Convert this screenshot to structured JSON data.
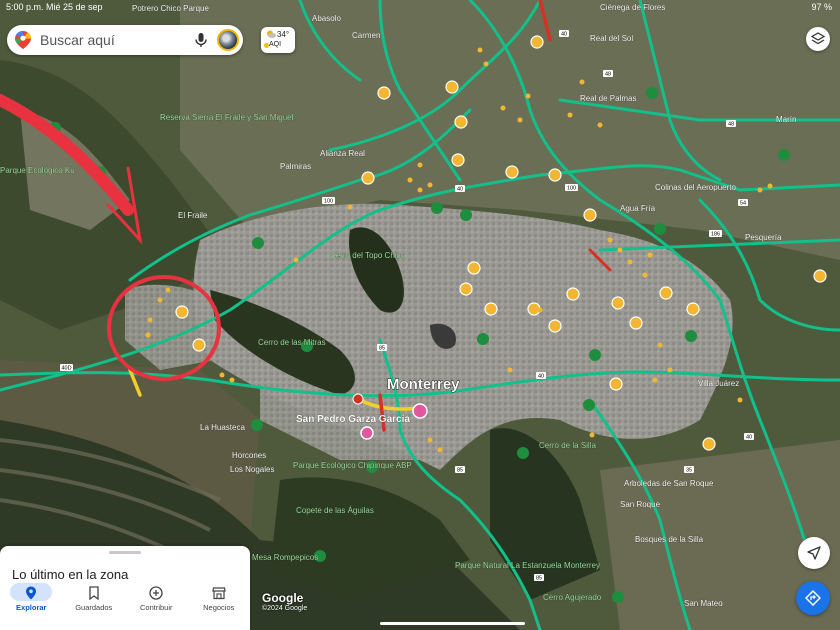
{
  "status_bar": {
    "time_date": "5:00 p.m.  Mié 25 de sep",
    "battery": "97 %"
  },
  "search": {
    "placeholder": "Buscar aquí"
  },
  "weather": {
    "temperature": "34°",
    "aqi_label": "AQI"
  },
  "map": {
    "city_label": "Monterrey",
    "places": [
      "Potrero Chico Parque",
      "Abasolo",
      "Carmen",
      "Ciénega de Flores",
      "Real del Sol",
      "Reserva Sierra El Fraile y San Miguel",
      "Real de Palmas",
      "Parque Ecológico Ku",
      "El Fraile",
      "Alianza Real",
      "Palmiras",
      "Colinas del Aeropuerto",
      "Agua Fría",
      "Pesquería",
      "Marín",
      "Cerro del Topo Chico",
      "Cerro de las Mitras",
      "San Pedro Garza García",
      "La Huasteca",
      "Horcones",
      "Los Nogales",
      "Parque Ecológico Chipinque ABP",
      "Copete de las Águilas",
      "Cerro de la Silla",
      "Arboledas de San Roque",
      "San Roque",
      "Bosques de la Silla",
      "Villa Juárez",
      "Parque Natural La Estanzuela Monterrey",
      "Cerro Agujerado",
      "San Mateo",
      "Mesa Rompepicos"
    ],
    "highway_numbers": [
      "40",
      "100",
      "85",
      "186",
      "54",
      "48",
      "60"
    ],
    "colors": {
      "traffic_green": "#11c08a",
      "traffic_yellow": "#f3cf29",
      "traffic_red": "#d93025",
      "annotation_red": "#e8323f",
      "park_marker": "#1e8e3e",
      "poi_marker": "#f2b632"
    }
  },
  "annotation": {
    "shape": "circle-with-arrow",
    "color": "#e8323f"
  },
  "bottom_sheet": {
    "title": "Lo último en la zona"
  },
  "tabs": [
    {
      "label": "Explorar",
      "icon": "location-pin-icon",
      "active": true
    },
    {
      "label": "Guardados",
      "icon": "bookmark-icon",
      "active": false
    },
    {
      "label": "Contribuir",
      "icon": "add-circle-icon",
      "active": false
    },
    {
      "label": "Negocios",
      "icon": "storefront-icon",
      "active": false
    }
  ],
  "attribution": {
    "logo": "Google",
    "copyright": "©2024 Google"
  }
}
